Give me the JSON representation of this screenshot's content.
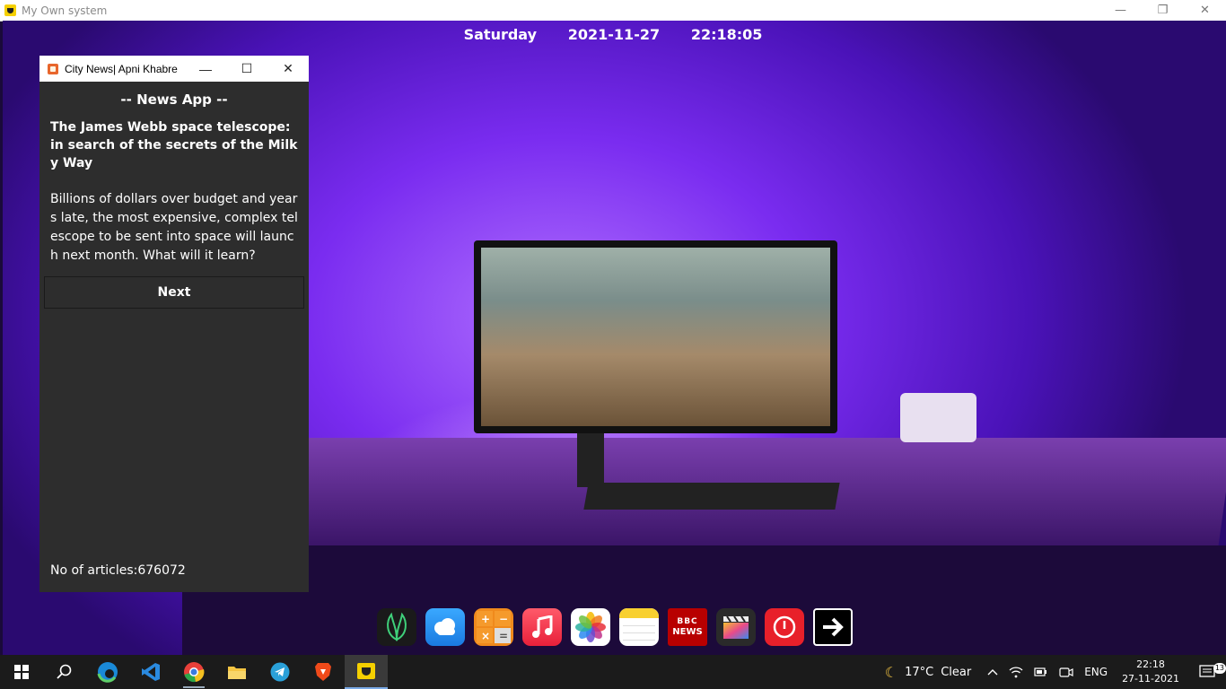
{
  "outer_window": {
    "title": "My Own system",
    "controls": {
      "minimize": "—",
      "restore": "❐",
      "close": "✕"
    }
  },
  "datetime": {
    "day": "Saturday",
    "date": "2021-11-27",
    "time": "22:18:05"
  },
  "news_window": {
    "title": "City News| Apni Khabre",
    "controls": {
      "minimize": "—",
      "maximize": "☐",
      "close": "✕"
    },
    "header": "-- News App --",
    "headline": "The James Webb space telescope: in search of the secrets of the Milky Way",
    "body": "Billions of dollars over budget and years late, the most expensive, complex telescope to be sent into space will launch next month. What will it learn?",
    "next_button": "Next",
    "article_count": "No of articles:676072"
  },
  "dock": {
    "items": [
      {
        "name": "leaf-app-icon",
        "color": "#1a1a1a"
      },
      {
        "name": "weather-icon",
        "color": "#2a9cf0"
      },
      {
        "name": "calculator-icon",
        "color": "#f08a1c"
      },
      {
        "name": "music-icon",
        "color": "#f0304a"
      },
      {
        "name": "photos-icon",
        "color": "#ffffff"
      },
      {
        "name": "notes-icon",
        "color": "#ffffff"
      },
      {
        "name": "bbc-news-icon",
        "color": "#b80000",
        "label_1": "BBC",
        "label_2": "NEWS"
      },
      {
        "name": "clapper-icon",
        "color": "#2a2a2a"
      },
      {
        "name": "power-icon",
        "color": "#e8202a"
      },
      {
        "name": "arrow-right-icon",
        "color": "#000000"
      }
    ]
  },
  "taskbar": {
    "items": [
      "start-icon",
      "search-icon",
      "edge-icon",
      "vscode-icon",
      "chrome-icon",
      "file-explorer-icon",
      "telegram-icon",
      "brave-icon",
      "app-icon"
    ],
    "weather": {
      "temp": "17°C",
      "condition": "Clear"
    },
    "language": "ENG",
    "clock_time": "22:18",
    "clock_date": "27-11-2021",
    "notification_count": "13"
  }
}
